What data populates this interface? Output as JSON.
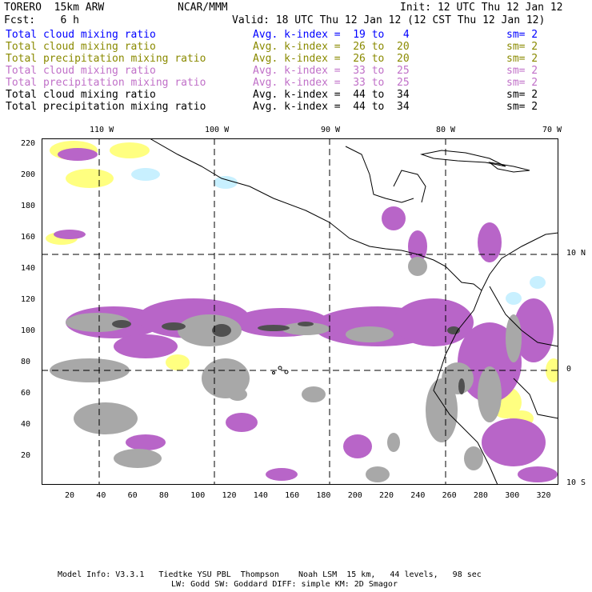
{
  "header": {
    "model": "TORERO  15km ARW",
    "org": "NCAR/MMM",
    "init": "Init: 12 UTC Thu 12 Jan 12",
    "fcst": "Fcst:    6 h",
    "valid": "Valid: 18 UTC Thu 12 Jan 12 (12 CST Thu 12 Jan 12)"
  },
  "legend": [
    {
      "field": "Total cloud mixing ratio",
      "index": "Avg. k-index =  19 to   4",
      "sm": "sm= 2",
      "color": "#0000ff"
    },
    {
      "field": "Total cloud mixing ratio",
      "index": "Avg. k-index =  26 to  20",
      "sm": "sm= 2",
      "color": "#8a8a00"
    },
    {
      "field": "Total precipitation mixing ratio",
      "index": "Avg. k-index =  26 to  20",
      "sm": "sm= 2",
      "color": "#8a8a00"
    },
    {
      "field": "Total cloud mixing ratio",
      "index": "Avg. k-index =  33 to  25",
      "sm": "sm= 2",
      "color": "#c070c8"
    },
    {
      "field": "Total precipitation mixing ratio",
      "index": "Avg. k-index =  33 to  25",
      "sm": "sm= 2",
      "color": "#c070c8"
    },
    {
      "field": "Total cloud mixing ratio",
      "index": "Avg. k-index =  44 to  34",
      "sm": "sm= 2",
      "color": "#000000"
    },
    {
      "field": "Total precipitation mixing ratio",
      "index": "Avg. k-index =  44 to  34",
      "sm": "sm= 2",
      "color": "#000000"
    }
  ],
  "axes": {
    "x_ticks": [
      "20",
      "40",
      "60",
      "80",
      "100",
      "120",
      "140",
      "160",
      "180",
      "200",
      "220",
      "240",
      "260",
      "280",
      "300",
      "320"
    ],
    "y_ticks": [
      "220",
      "200",
      "180",
      "160",
      "140",
      "120",
      "100",
      "80",
      "60",
      "40",
      "20"
    ],
    "lon_labels": [
      "110 W",
      "100 W",
      "90 W",
      "80 W",
      "70 W"
    ],
    "lat_labels": [
      "10 N",
      "0",
      "10 S"
    ]
  },
  "footer": {
    "line1": "Model Info: V3.3.1   Tiedtke YSU PBL  Thompson    Noah LSM  15 km,   44 levels,   98 sec",
    "line2": "LW: Godd SW: Goddard DIFF: simple KM: 2D Smagor"
  }
}
